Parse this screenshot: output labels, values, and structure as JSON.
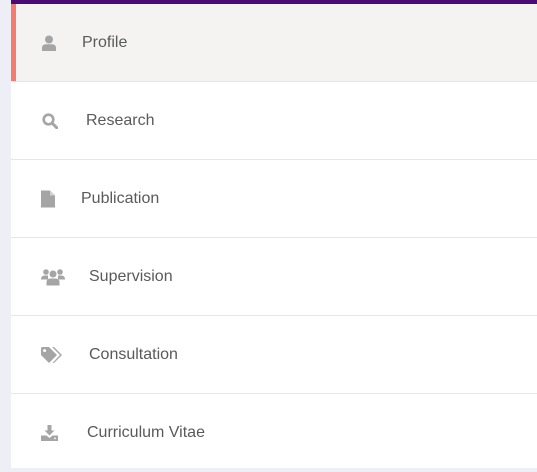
{
  "menu": {
    "items": [
      {
        "label": "Profile",
        "icon": "user-icon",
        "active": true
      },
      {
        "label": "Research",
        "icon": "search-icon",
        "active": false
      },
      {
        "label": "Publication",
        "icon": "file-icon",
        "active": false
      },
      {
        "label": "Supervision",
        "icon": "users-icon",
        "active": false
      },
      {
        "label": "Consultation",
        "icon": "tags-icon",
        "active": false
      },
      {
        "label": "Curriculum Vitae",
        "icon": "download-icon",
        "active": false
      }
    ]
  },
  "colors": {
    "top_bar": "#4b0a78",
    "active_indicator": "#f37b6f",
    "active_background": "#f4f3f1",
    "icon": "#a5a5a5",
    "text": "#5a5a5a",
    "page_background": "#eeeff6"
  }
}
